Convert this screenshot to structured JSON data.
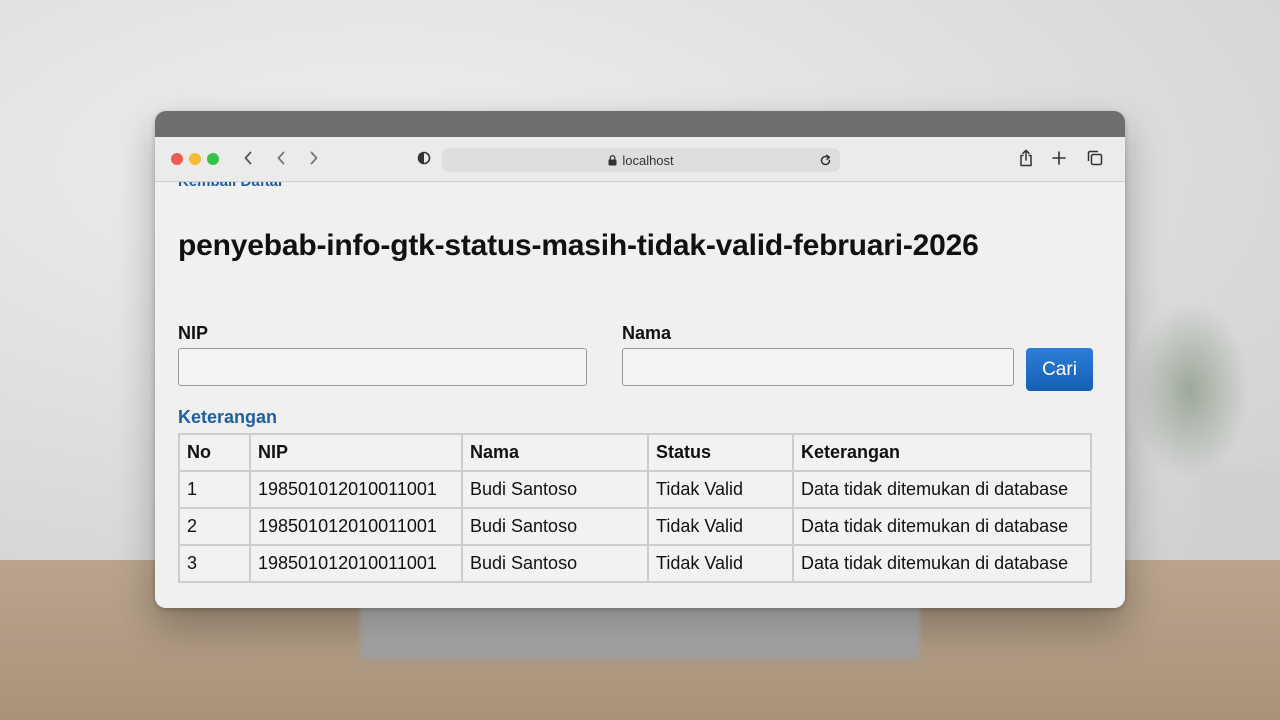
{
  "browser": {
    "address": "localhost"
  },
  "page": {
    "cut_link": "Kembali Daftar",
    "title": "penyebab-info-gtk-status-masih-tidak-valid-februari-2026"
  },
  "form": {
    "nip_label": "NIP",
    "nip_value": "",
    "nama_label": "Nama",
    "nama_value": "",
    "search_label": "Cari"
  },
  "results": {
    "section_label": "Keterangan",
    "columns": [
      "No",
      "NIP",
      "Nama",
      "Status",
      "Keterangan"
    ],
    "rows": [
      [
        "1",
        "198501012010011001",
        "Budi Santoso",
        "Tidak Valid",
        "Data tidak ditemukan di database"
      ],
      [
        "2",
        "198501012010011001",
        "Budi Santoso",
        "Tidak Valid",
        "Data tidak ditemukan di database"
      ],
      [
        "3",
        "198501012010011001",
        "Budi Santoso",
        "Tidak Valid",
        "Data tidak ditemukan di database"
      ]
    ]
  },
  "colors": {
    "link": "#1f5fa3",
    "button": "#1a66c2",
    "close": "#ee5b53",
    "minimize": "#f2bb33",
    "zoom": "#34c248"
  },
  "icons": [
    "back-icon",
    "forward-icon",
    "shield-icon",
    "lock-icon",
    "reload-icon",
    "share-icon",
    "new-tab-icon",
    "tabs-overview-icon"
  ]
}
